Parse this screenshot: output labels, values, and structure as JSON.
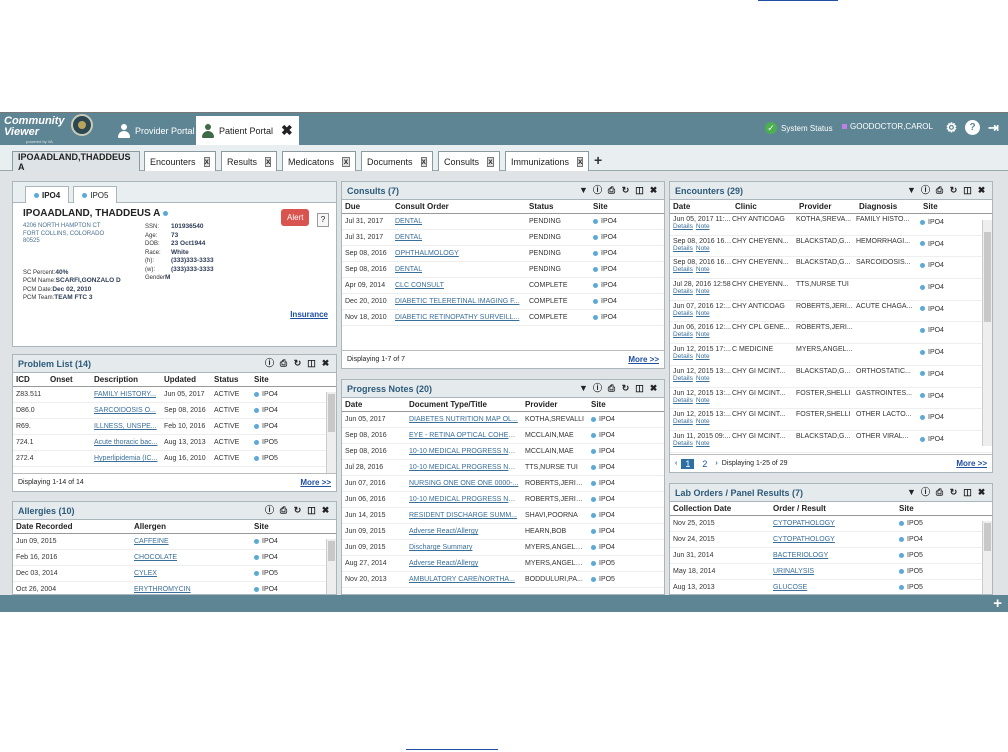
{
  "app": {
    "logo_text": [
      "Community",
      "Viewer"
    ],
    "logo_subtext": "powered by VA",
    "portals": [
      {
        "label": "Provider Portal"
      },
      {
        "label": "Patient Portal"
      }
    ],
    "system_status": "System Status",
    "user": "GOODOCTOR,CAROL"
  },
  "workspace_tabs": [
    {
      "label": "IPOAADLAND,THADDEUS A"
    },
    {
      "label": "Encounters"
    },
    {
      "label": "Results"
    },
    {
      "label": "Medicatons"
    },
    {
      "label": "Documents"
    },
    {
      "label": "Consults"
    },
    {
      "label": "Immunizations"
    }
  ],
  "patient": {
    "sites": [
      "IPO4",
      "IPO5"
    ],
    "name": "IPOAADLAND, THADDEUS A",
    "address_lines": [
      "4206 NORTH HAMPTON CT",
      "FORT COLLINS, COLORADO",
      "80525"
    ],
    "ssn_label": "SSN:",
    "ssn": "101936540",
    "age_label": "Age:",
    "age": "73",
    "dob_label": "DOB:",
    "dob": "23 Oct1944",
    "race_label": "Race:",
    "race": "White",
    "home_label": "(h):",
    "home": "(333)333-3333",
    "work_label": "(w):",
    "work": "(333)333-3333",
    "gender_label": "Gender",
    "gender": "M",
    "sc_label": "SC Percent:",
    "sc": "40%",
    "pcm_name_label": "PCM Name:",
    "pcm_name": "SCARFI,GONZALO D",
    "pcm_date_label": "PCM Date:",
    "pcm_date": "Dec 02, 2010",
    "pcm_team_label": "PCM Team:",
    "pcm_team": "TEAM FTC 3",
    "alert": "Alert",
    "help": "?",
    "insurance": "Insurance"
  },
  "problem_list": {
    "title": "Problem List (14)",
    "headers": [
      "ICD",
      "Onset",
      "Description",
      "Updated",
      "Status",
      "Site"
    ],
    "rows": [
      [
        "Z83.511",
        "",
        "FAMILY HISTORY...",
        "Jun 05, 2017",
        "ACTIVE",
        "IPO4"
      ],
      [
        "D86.0",
        "",
        "SARCOIDOSIS O...",
        "Sep 08, 2016",
        "ACTIVE",
        "IPO4"
      ],
      [
        "R69.",
        "",
        "ILLNESS, UNSPE...",
        "Feb 10, 2016",
        "ACTIVE",
        "IPO4"
      ],
      [
        "724.1",
        "",
        "Acute thoracic bac...",
        "Aug 13, 2013",
        "ACTIVE",
        "IPO5"
      ],
      [
        "272.4",
        "",
        "Hyperlipidemia (IC...",
        "Aug 16, 2010",
        "ACTIVE",
        "IPO5"
      ]
    ],
    "footer": "Displaying 1-14 of 14",
    "more": "More >>"
  },
  "allergies": {
    "title": "Allergies (10)",
    "headers": [
      "Date Recorded",
      "Allergen",
      "Site"
    ],
    "rows": [
      [
        "Jun 09, 2015",
        "CAFFEINE",
        "IPO4"
      ],
      [
        "Feb 16, 2016",
        "CHOCOLATE",
        "IPO4"
      ],
      [
        "Dec 03, 2014",
        "CYLEX",
        "IPO5"
      ],
      [
        "Oct 26, 2004",
        "ERYTHROMYCIN",
        "IPO4"
      ]
    ]
  },
  "consults": {
    "title": "Consults (7)",
    "headers": [
      "Due",
      "Consult Order",
      "Status",
      "Site"
    ],
    "rows": [
      [
        "Jul 31, 2017",
        "DENTAL",
        "PENDING",
        "IPO4"
      ],
      [
        "Jul 31, 2017",
        "DENTAL",
        "PENDING",
        "IPO4"
      ],
      [
        "Sep 08, 2016",
        "OPHTHALMOLOGY",
        "PENDING",
        "IPO4"
      ],
      [
        "Sep 08, 2016",
        "DENTAL",
        "PENDING",
        "IPO4"
      ],
      [
        "Apr 09, 2014",
        "CLC CONSULT",
        "COMPLETE",
        "IPO4"
      ],
      [
        "Dec 20, 2010",
        "DIABETIC TELERETINAL IMAGING F...",
        "COMPLETE",
        "IPO4"
      ],
      [
        "Nov 18, 2010",
        "DIABETIC RETINOPATHY SURVEILL...",
        "COMPLETE",
        "IPO4"
      ]
    ],
    "footer": "Displaying 1-7 of 7",
    "more": "More >>"
  },
  "progress_notes": {
    "title": "Progress Notes (20)",
    "headers": [
      "Date",
      "Document Type/Title",
      "Provider",
      "Site"
    ],
    "rows": [
      [
        "Jun 05, 2017",
        "DIABETES NUTRITION MAP OL...",
        "KOTHA,SREVALLI",
        "IPO4"
      ],
      [
        "Sep 08, 2016",
        "EYE - RETINA OPTICAL COHER...",
        "MCCLAIN,MAE",
        "IPO4"
      ],
      [
        "Sep 08, 2016",
        "10-10 MEDICAL PROGRESS NO...",
        "MCCLAIN,MAE",
        "IPO4"
      ],
      [
        "Jul 28, 2016",
        "10-10 MEDICAL PROGRESS NO...",
        "TTS,NURSE TUI",
        "IPO4"
      ],
      [
        "Jun 07, 2016",
        "NURSING ONE ONE ONE 0000-...",
        "ROBERTS,JERIL...",
        "IPO4"
      ],
      [
        "Jun 06, 2016",
        "10-10 MEDICAL PROGRESS NO...",
        "ROBERTS,JERIL...",
        "IPO4"
      ],
      [
        "Jun 14, 2015",
        "RESIDENT DISCHARGE SUMM...",
        "SHAVI,POORNA",
        "IPO4"
      ],
      [
        "Jun 09, 2015",
        "Adverse React/Allergy",
        "HEARN,BOB",
        "IPO4"
      ],
      [
        "Jun 09, 2015",
        "Discharge Summary",
        "MYERS,ANGELA...",
        "IPO4"
      ],
      [
        "Aug 27, 2014",
        "Adverse React/Allergy",
        "MYERS,ANGELA...",
        "IPO5"
      ],
      [
        "Nov 20, 2013",
        "AMBULATORY CARE/NORTHA...",
        "BODDULURI,PA...",
        "IPO5"
      ]
    ]
  },
  "encounters": {
    "title": "Encounters (29)",
    "headers": [
      "Date",
      "Clinic",
      "Provider",
      "Diagnosis",
      "Site"
    ],
    "rows": [
      [
        "Jun 05, 2017 11:...",
        "CHY ANTICOAG",
        "KOTHA,SREVA...",
        "FAMILY HISTO...",
        "IPO4"
      ],
      [
        "Sep 08, 2016 16:...",
        "CHY CHEYENN...",
        "BLACKSTAD,G...",
        "HEMORRHAGI...",
        "IPO4"
      ],
      [
        "Sep 08, 2016 16:...",
        "CHY CHEYENN...",
        "BLACKSTAD,G...",
        "SARCOIDOSIS...",
        "IPO4"
      ],
      [
        "Jul 28, 2016 12:58",
        "CHY CHEYENN...",
        "TTS,NURSE TUI",
        "",
        "IPO4"
      ],
      [
        "Jun 07, 2016 12:...",
        "CHY ANTICOAG",
        "ROBERTS,JERI...",
        "ACUTE CHAGA...",
        "IPO4"
      ],
      [
        "Jun 06, 2016 12:...",
        "CHY CPL GENE...",
        "ROBERTS,JERI...",
        "",
        "IPO4"
      ],
      [
        "Jun 12, 2015 17:...",
        "C MEDICINE",
        "MYERS,ANGEL...",
        "",
        "IPO4"
      ],
      [
        "Jun 12, 2015 13:...",
        "CHY GI MCINT...",
        "BLACKSTAD,G...",
        "ORTHOSTATIC...",
        "IPO4"
      ],
      [
        "Jun 12, 2015 13:...",
        "CHY GI MCINT...",
        "FOSTER,SHELLI",
        "GASTROINTES...",
        "IPO4"
      ],
      [
        "Jun 12, 2015 13:...",
        "CHY GI MCINT...",
        "FOSTER,SHELLI",
        "OTHER LACTO...",
        "IPO4"
      ],
      [
        "Jun 11, 2015 09:...",
        "CHY GI MCINT...",
        "BLACKSTAD,G...",
        "OTHER VIRAL...",
        "IPO4"
      ]
    ],
    "row_links": [
      "Details",
      "Note"
    ],
    "pages": [
      "1",
      "2"
    ],
    "footer": "Displaying 1-25 of 29",
    "more": "More >>"
  },
  "lab_orders": {
    "title": "Lab Orders / Panel Results (7)",
    "headers": [
      "Collection Date",
      "Order / Result",
      "Site"
    ],
    "rows": [
      [
        "Nov 25, 2015",
        "CYTOPATHOLOGY",
        "IPO5"
      ],
      [
        "Nov 24, 2015",
        "CYTOPATHOLOGY",
        "IPO4"
      ],
      [
        "Jun 31, 2014",
        "BACTERIOLOGY",
        "IPO5"
      ],
      [
        "May 18, 2014",
        "URINALYSIS",
        "IPO5"
      ],
      [
        "Aug 13, 2013",
        "GLUCOSE",
        "IPO5"
      ]
    ]
  }
}
